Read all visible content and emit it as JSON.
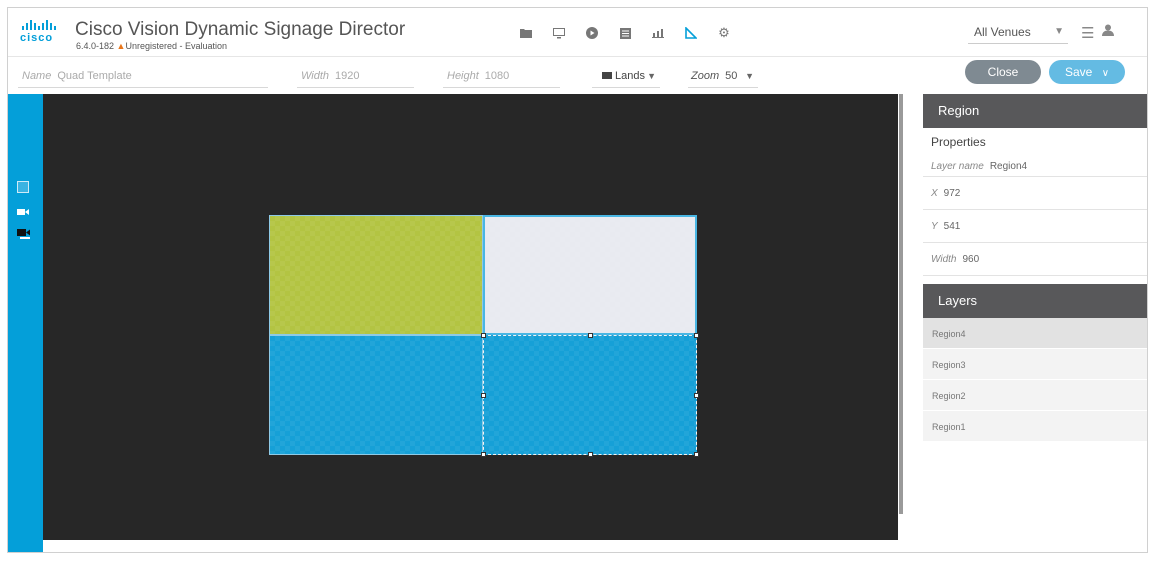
{
  "header": {
    "brand": "cisco",
    "app_title": "Cisco Vision Dynamic Signage Director",
    "version": "6.4.0-182",
    "warning": "Unregistered - Evaluation",
    "toolbar_icons": [
      "folder-icon",
      "monitor-icon",
      "play-icon",
      "list-icon",
      "bar-chart-icon",
      "template-icon",
      "gear-icon"
    ],
    "active_icon": "template-icon",
    "venue_select": "All Venues"
  },
  "props": {
    "name_label": "Name",
    "name_value": "Quad Template",
    "width_label": "Width",
    "width_value": "1920",
    "height_label": "Height",
    "height_value": "1080",
    "orientation_value": "Lands",
    "zoom_label": "Zoom",
    "zoom_value": "50"
  },
  "buttons": {
    "close": "Close",
    "save": "Save"
  },
  "rail_icons": [
    "square-icon",
    "video-icon",
    "video-layer-icon"
  ],
  "regions": [
    {
      "name": "Region1",
      "color": "#b3c442"
    },
    {
      "name": "Region2",
      "color": "#e8eaf0"
    },
    {
      "name": "Region3",
      "color": "#16a0d7"
    },
    {
      "name": "Region4",
      "color": "#16a0d7"
    }
  ],
  "panel": {
    "region_header": "Region",
    "properties_title": "Properties",
    "layer_name_label": "Layer name",
    "layer_name": "Region4",
    "x_label": "X",
    "x_value": "972",
    "y_label": "Y",
    "y_value": "541",
    "width_label": "Width",
    "width_value": "960",
    "layers_header": "Layers",
    "layers": [
      "Region4",
      "Region3",
      "Region2",
      "Region1"
    ],
    "selected_layer": "Region4"
  },
  "colors": {
    "accent": "#049fd9",
    "panel_header": "#58585a",
    "canvas": "#272727"
  }
}
